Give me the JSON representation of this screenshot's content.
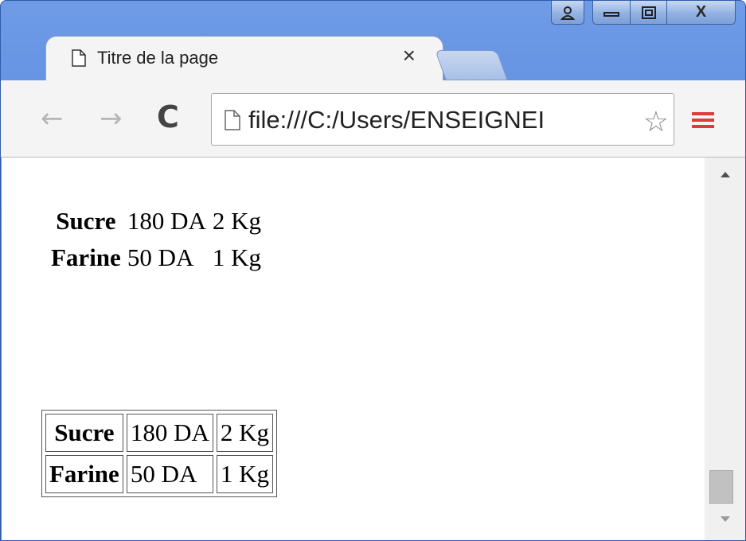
{
  "window": {
    "tab_title": "Titre de la page",
    "tab_close": "×",
    "caption": {
      "user": "user-icon",
      "min": "minimize-icon",
      "max": "maximize-icon",
      "close": "X"
    }
  },
  "toolbar": {
    "back": "←",
    "forward": "→",
    "reload": "C",
    "address": "file:///C:/Users/ENSEIGNEI",
    "star": "☆"
  },
  "content": {
    "plain_rows": [
      {
        "name": "Sucre",
        "price": "180 DA",
        "qty": "2 Kg"
      },
      {
        "name": "Farine",
        "price": "50 DA",
        "qty": "1 Kg"
      }
    ],
    "table_rows": [
      {
        "name": "Sucre",
        "price": "180 DA",
        "qty": "2 Kg"
      },
      {
        "name": "Farine",
        "price": "50 DA",
        "qty": "1 Kg"
      }
    ]
  },
  "colors": {
    "frame": "#4c80dc",
    "menu": "#e03a3a"
  }
}
